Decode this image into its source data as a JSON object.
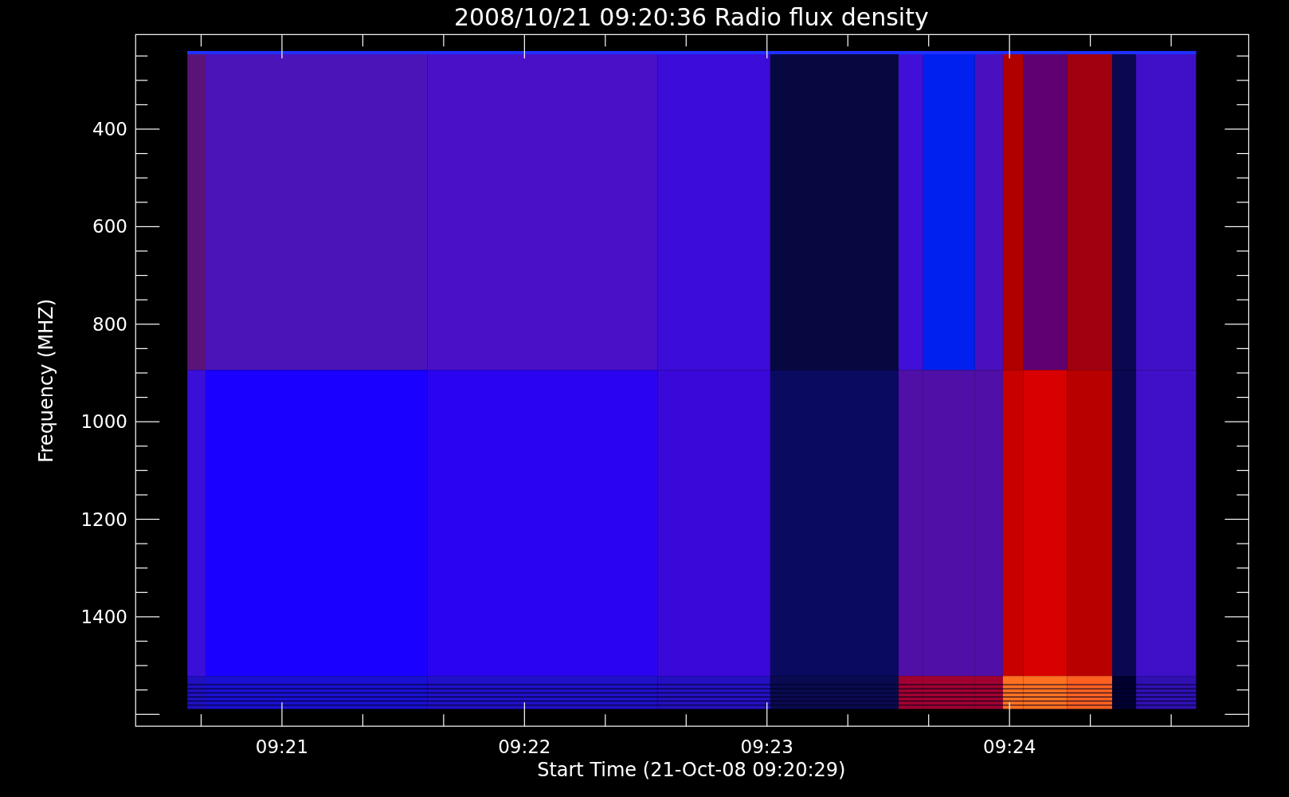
{
  "title": "2008/10/21 09:20:36 Radio flux density",
  "y_axis": {
    "label": "Frequency (MHZ)",
    "ticks": [
      "400",
      "600",
      "800",
      "1000",
      "1200",
      "1400"
    ]
  },
  "x_axis": {
    "label": "Start Time (21-Oct-08 09:20:29)",
    "ticks": [
      "09:21",
      "09:22",
      "09:23",
      "09:24"
    ]
  }
}
